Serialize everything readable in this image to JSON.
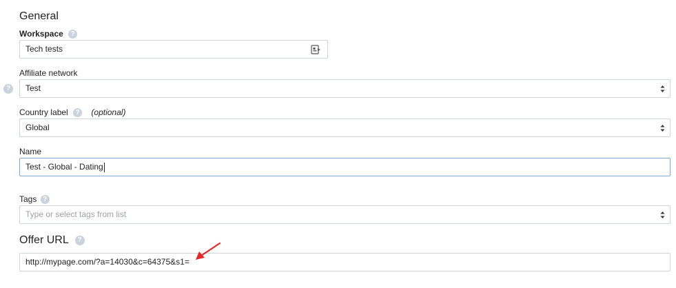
{
  "general": {
    "title": "General",
    "workspace": {
      "label": "Workspace",
      "value": "Tech tests",
      "help": "?"
    },
    "affiliate_network": {
      "label": "Affiliate network",
      "value": "Test",
      "help": "?"
    },
    "country_label": {
      "label": "Country label",
      "optional": "(optional)",
      "value": "Global",
      "help": "?"
    },
    "name": {
      "label": "Name",
      "value": "Test - Global - Dating"
    },
    "tags": {
      "label": "Tags",
      "placeholder": "Type or select tags from list",
      "help": "?"
    }
  },
  "offer_url": {
    "title": "Offer URL",
    "help": "?",
    "value": "http://mypage.com/?a=14030&c=64375&s1="
  },
  "colors": {
    "arrow": "#e8262a",
    "help_icon": "#c9d3dd",
    "border": "#cfd5db",
    "focus_border": "#7fa7cf"
  }
}
